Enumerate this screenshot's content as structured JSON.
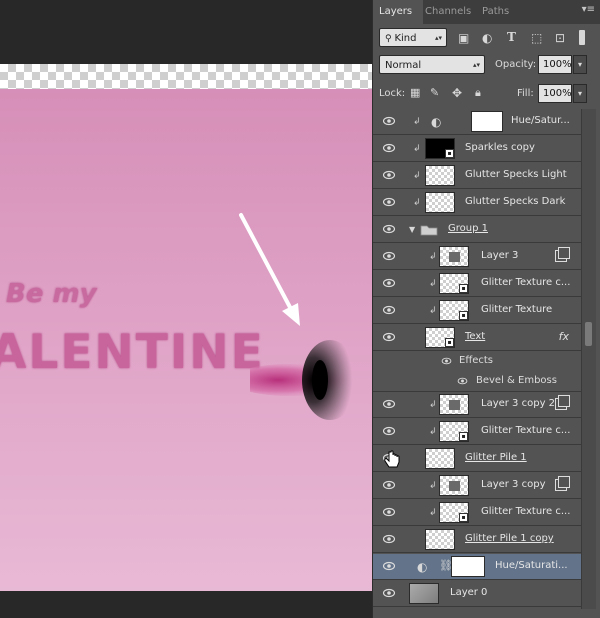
{
  "canvas": {
    "be_my_text": "Be my",
    "valentine_text": "ALENTINE"
  },
  "panel": {
    "tabs": [
      {
        "label": "Layers",
        "active": true
      },
      {
        "label": "Channels",
        "active": false
      },
      {
        "label": "Paths",
        "active": false
      }
    ],
    "filter": {
      "kind_label": "Kind"
    },
    "blend": {
      "mode": "Normal",
      "opacity_label": "Opacity:",
      "opacity_value": "100%"
    },
    "lock": {
      "lock_label": "Lock:",
      "fill_label": "Fill:",
      "fill_value": "100%"
    },
    "layers": [
      {
        "name": "Hue/Satur...",
        "thumb": "white",
        "clipped": true,
        "adjustment": true
      },
      {
        "name": "Sparkles copy",
        "thumb": "black",
        "clipped": true
      },
      {
        "name": "Glutter Specks Light",
        "thumb": "checker",
        "clipped": true
      },
      {
        "name": "Glutter Specks Dark",
        "thumb": "checker",
        "clipped": true
      },
      {
        "name": "Group 1",
        "thumb": "folder",
        "group": true
      },
      {
        "name": "Layer 3",
        "thumb": "checker",
        "clipped": true
      },
      {
        "name": "Glitter Texture c...",
        "thumb": "checker",
        "clipped": true
      },
      {
        "name": "Glitter Texture",
        "thumb": "checker",
        "clipped": true
      },
      {
        "name": "Text",
        "thumb": "checker",
        "fx": "fx"
      },
      {
        "name": "Layer 3 copy 2",
        "thumb": "checker",
        "clipped": true
      },
      {
        "name": "Glitter Texture c...",
        "thumb": "checker",
        "clipped": true
      },
      {
        "name": "Glitter Pile 1",
        "thumb": "checker"
      },
      {
        "name": "Layer 3 copy",
        "thumb": "checker",
        "clipped": true
      },
      {
        "name": "Glitter Texture c...",
        "thumb": "checker",
        "clipped": true
      },
      {
        "name": "Glitter Pile 1 copy",
        "thumb": "checker"
      },
      {
        "name": "Hue/Saturati...",
        "thumb": "white",
        "selected": true,
        "adjustment": true
      },
      {
        "name": "Layer 0",
        "thumb": "gray"
      }
    ],
    "effects": {
      "effects_label": "Effects",
      "bevel_label": "Bevel & Emboss"
    }
  }
}
